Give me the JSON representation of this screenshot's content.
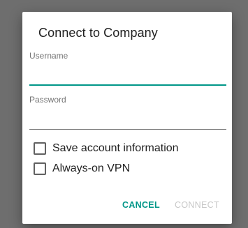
{
  "dialog": {
    "title": "Connect to Company",
    "username": {
      "label": "Username",
      "value": ""
    },
    "password": {
      "label": "Password",
      "value": ""
    },
    "options": [
      {
        "label": "Save account information",
        "checked": false
      },
      {
        "label": "Always-on VPN",
        "checked": false
      }
    ],
    "actions": {
      "cancel_label": "CANCEL",
      "connect_label": "CONNECT",
      "connect_enabled": false
    }
  },
  "colors": {
    "accent": "#009688",
    "disabled_text": "#c8c8c8",
    "scrim": "#6e6e6e"
  }
}
